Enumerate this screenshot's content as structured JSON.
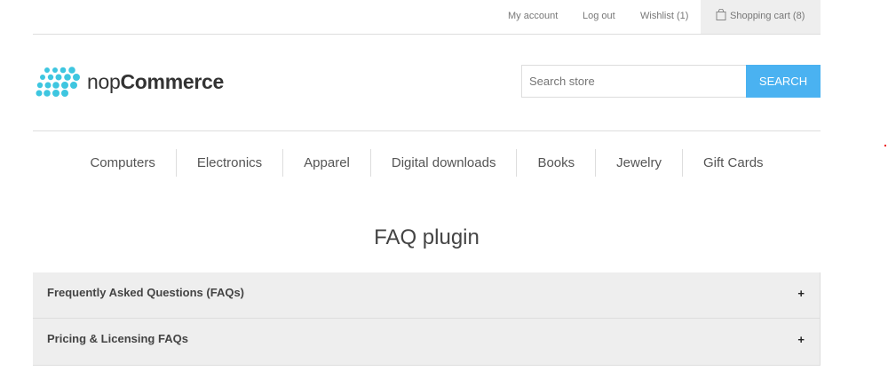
{
  "header": {
    "my_account": "My account",
    "log_out": "Log out",
    "wishlist": "Wishlist (1)",
    "shopping_cart": "Shopping cart (8)"
  },
  "logo": {
    "prefix": "nop",
    "brand": "Commerce",
    "icon": "logo-dots-icon",
    "color": "#3ec6e0"
  },
  "search": {
    "placeholder": "Search store",
    "button_label": "Search",
    "button_color": "#4ab2f1"
  },
  "menu": {
    "items": [
      "Computers",
      "Electronics",
      "Apparel",
      "Digital downloads",
      "Books",
      "Jewelry",
      "Gift Cards"
    ]
  },
  "page": {
    "title": "FAQ plugin"
  },
  "faq": {
    "sections": [
      {
        "title": "Frequently Asked Questions (FAQs)",
        "toggle": "+"
      },
      {
        "title": "Pricing & Licensing FAQs",
        "toggle": "+"
      }
    ]
  }
}
